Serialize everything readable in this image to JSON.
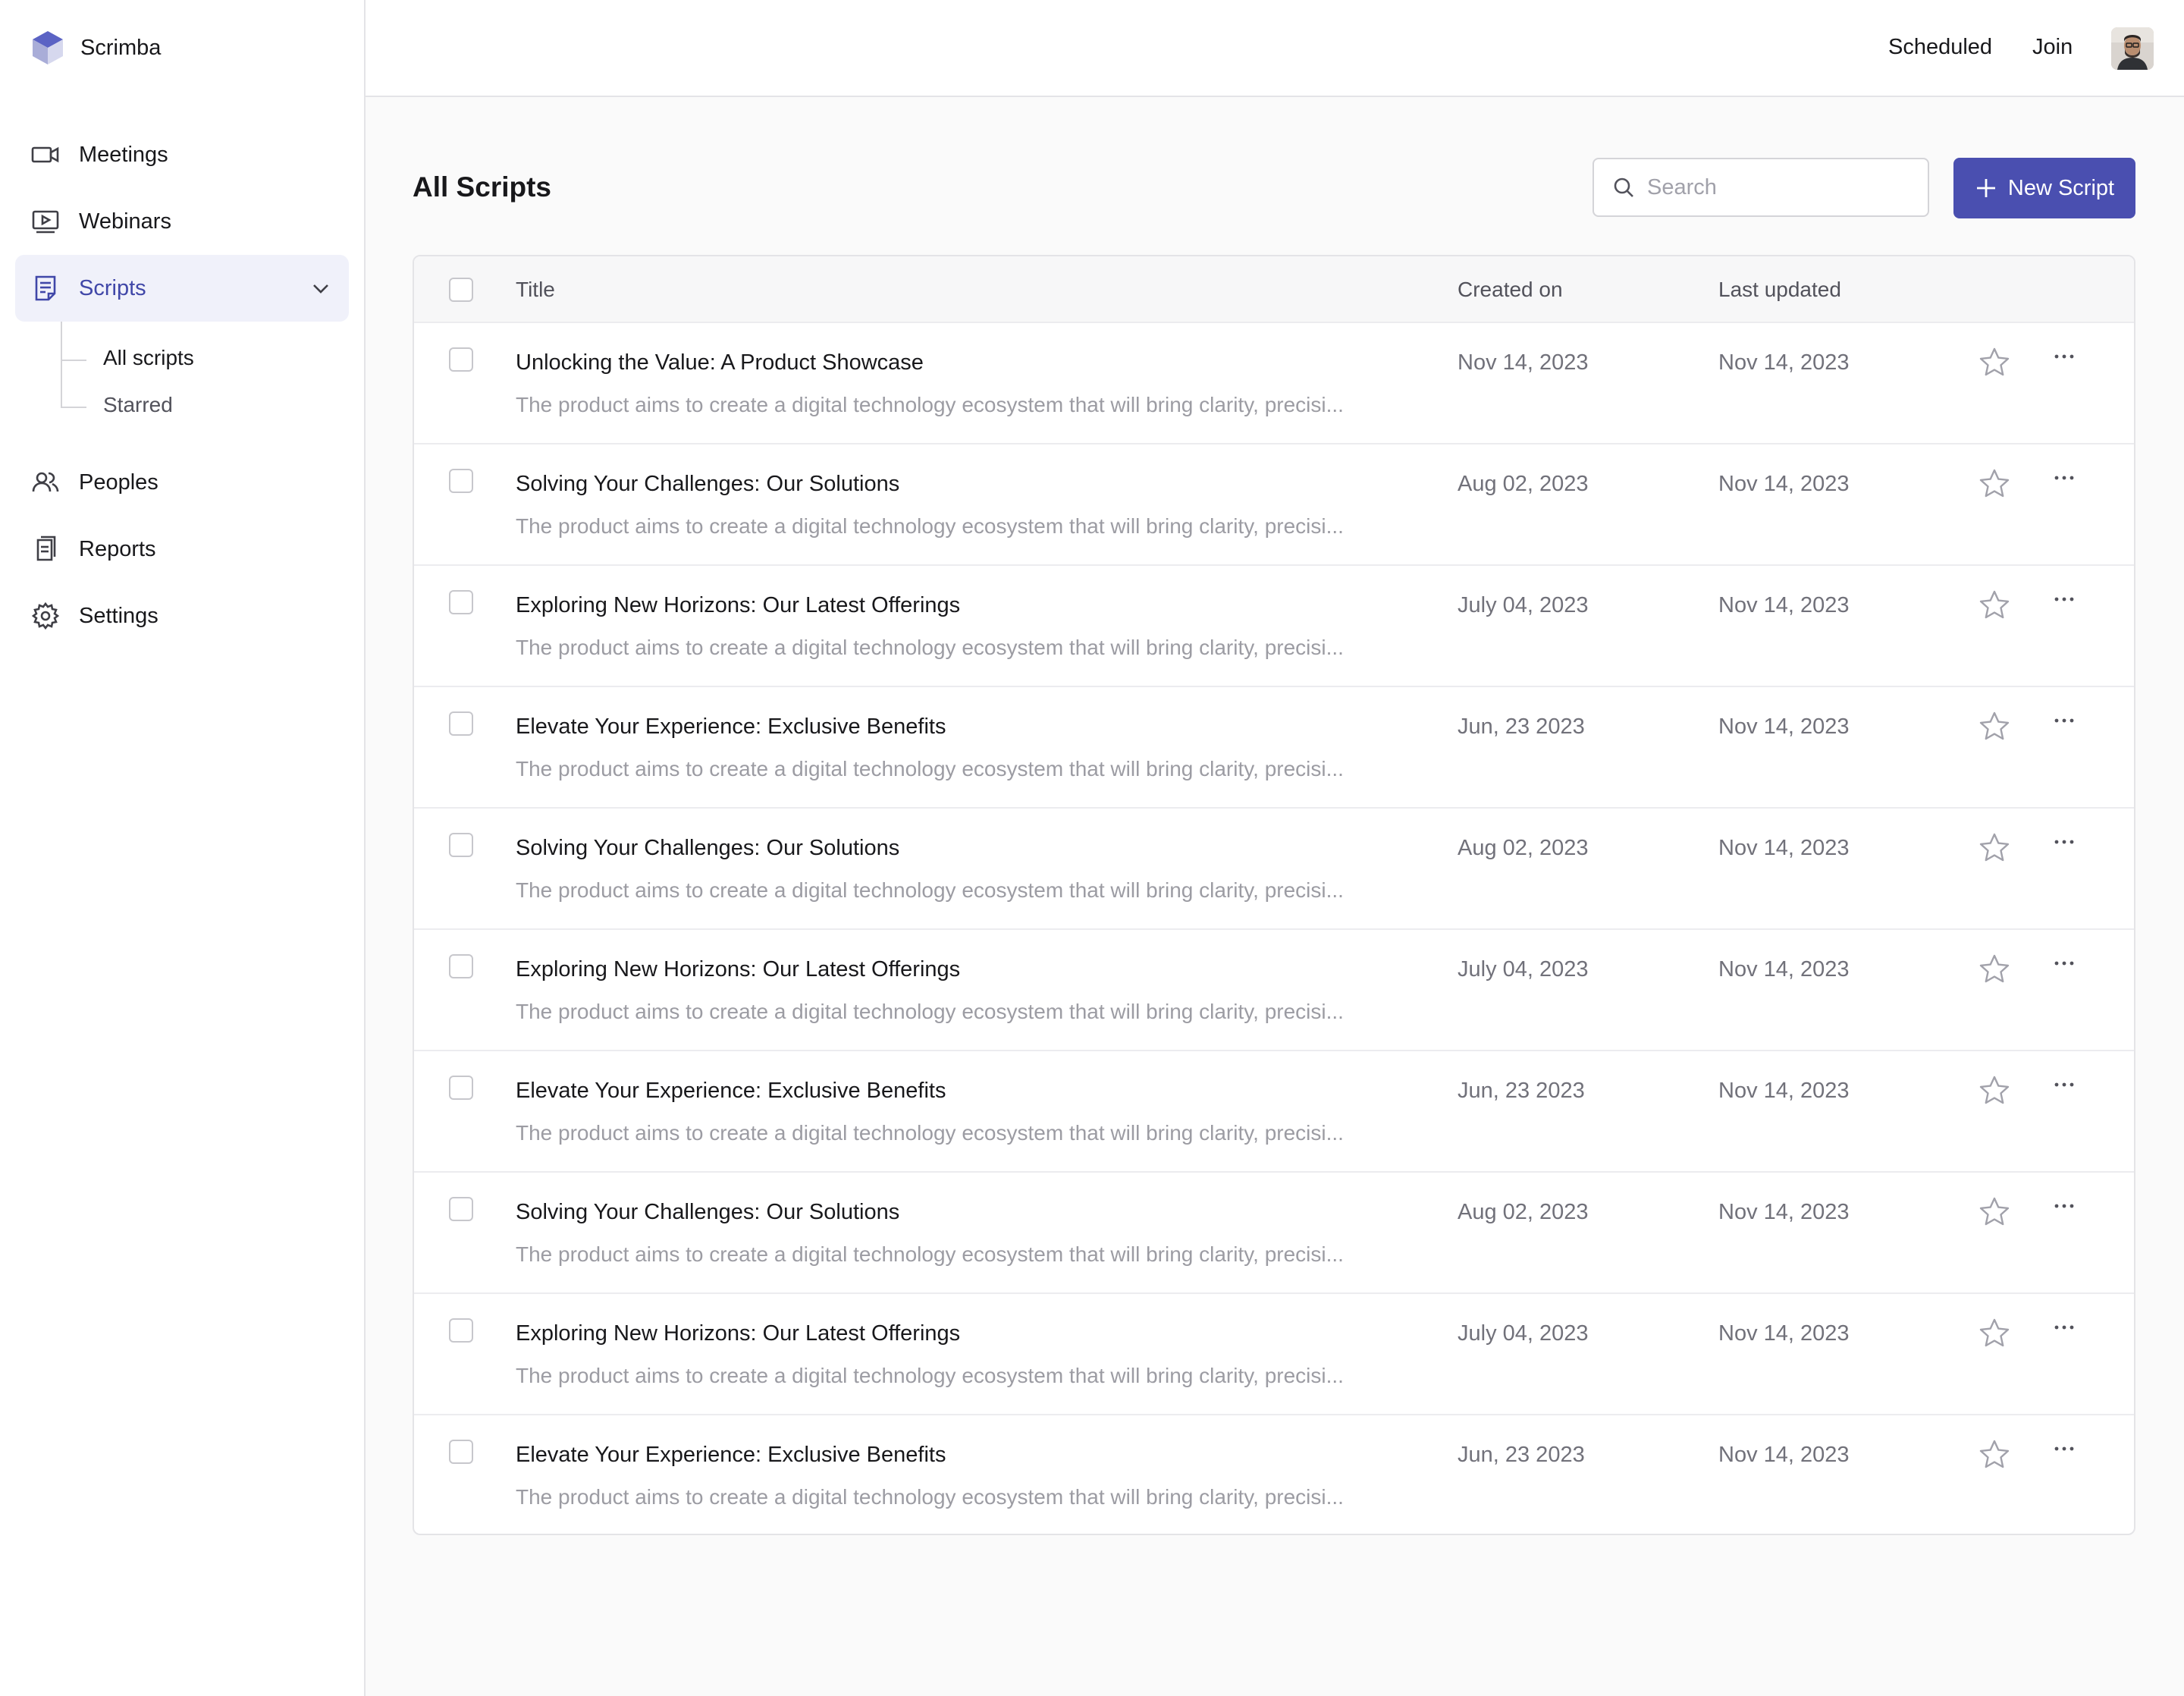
{
  "brand": {
    "name": "Scrimba",
    "accent": "#4a4fb0"
  },
  "sidebar": {
    "items": [
      {
        "label": "Meetings",
        "icon": "video-camera-icon"
      },
      {
        "label": "Webinars",
        "icon": "play-screen-icon"
      },
      {
        "label": "Scripts",
        "icon": "document-icon",
        "active": true
      },
      {
        "label": "Peoples",
        "icon": "users-icon"
      },
      {
        "label": "Reports",
        "icon": "report-icon"
      },
      {
        "label": "Settings",
        "icon": "gear-icon"
      }
    ],
    "scripts_sub": [
      {
        "label": "All scripts",
        "active": true
      },
      {
        "label": "Starred"
      }
    ]
  },
  "topbar": {
    "scheduled": "Scheduled",
    "join": "Join"
  },
  "main": {
    "title": "All Scripts",
    "search_placeholder": "Search",
    "new_button": "New Script"
  },
  "table": {
    "headers": {
      "title": "Title",
      "created": "Created on",
      "updated": "Last updated"
    },
    "rows": [
      {
        "title": "Unlocking the Value: A Product Showcase",
        "desc": "The product aims to create a digital technology ecosystem that will bring clarity, precisi...",
        "created": "Nov 14, 2023",
        "updated": "Nov 14, 2023"
      },
      {
        "title": "Solving Your Challenges: Our Solutions",
        "desc": "The product aims to create a digital technology ecosystem that will bring clarity, precisi...",
        "created": "Aug 02, 2023",
        "updated": "Nov 14, 2023"
      },
      {
        "title": "Exploring New Horizons: Our Latest Offerings",
        "desc": "The product aims to create a digital technology ecosystem that will bring clarity, precisi...",
        "created": "July 04, 2023",
        "updated": "Nov 14, 2023"
      },
      {
        "title": "Elevate Your Experience: Exclusive Benefits",
        "desc": "The product aims to create a digital technology ecosystem that will bring clarity, precisi...",
        "created": "Jun, 23 2023",
        "updated": "Nov 14, 2023"
      },
      {
        "title": "Solving Your Challenges: Our Solutions",
        "desc": "The product aims to create a digital technology ecosystem that will bring clarity, precisi...",
        "created": "Aug 02, 2023",
        "updated": "Nov 14, 2023"
      },
      {
        "title": "Exploring New Horizons: Our Latest Offerings",
        "desc": "The product aims to create a digital technology ecosystem that will bring clarity, precisi...",
        "created": "July 04, 2023",
        "updated": "Nov 14, 2023"
      },
      {
        "title": "Elevate Your Experience: Exclusive Benefits",
        "desc": "The product aims to create a digital technology ecosystem that will bring clarity, precisi...",
        "created": "Jun, 23 2023",
        "updated": "Nov 14, 2023"
      },
      {
        "title": "Solving Your Challenges: Our Solutions",
        "desc": "The product aims to create a digital technology ecosystem that will bring clarity, precisi...",
        "created": "Aug 02, 2023",
        "updated": "Nov 14, 2023"
      },
      {
        "title": "Exploring New Horizons: Our Latest Offerings",
        "desc": "The product aims to create a digital technology ecosystem that will bring clarity, precisi...",
        "created": "July 04, 2023",
        "updated": "Nov 14, 2023"
      },
      {
        "title": "Elevate Your Experience: Exclusive Benefits",
        "desc": "The product aims to create a digital technology ecosystem that will bring clarity, precisi...",
        "created": "Jun, 23 2023",
        "updated": "Nov 14, 2023"
      }
    ]
  }
}
